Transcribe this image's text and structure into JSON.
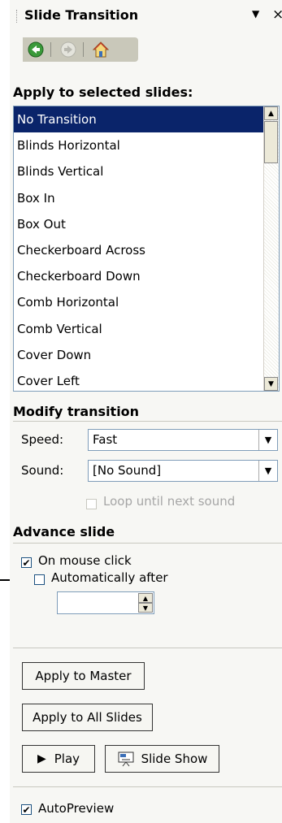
{
  "panel": {
    "title": "Slide Transition",
    "menu_glyph": "▼",
    "close_glyph": "×"
  },
  "nav": {
    "back_icon": "back-arrow-icon",
    "forward_icon": "forward-arrow-icon",
    "home_icon": "home-icon"
  },
  "apply_section": {
    "heading": "Apply to selected slides:",
    "items": [
      "No Transition",
      "Blinds Horizontal",
      "Blinds Vertical",
      "Box In",
      "Box Out",
      "Checkerboard Across",
      "Checkerboard Down",
      "Comb Horizontal",
      "Comb Vertical",
      "Cover Down",
      "Cover Left"
    ],
    "selected_index": 0
  },
  "modify": {
    "heading": "Modify transition",
    "speed_label": "Speed:",
    "speed_value": "Fast",
    "sound_label": "Sound:",
    "sound_value": "[No Sound]",
    "loop_label": "Loop until next sound",
    "loop_checked": false
  },
  "advance": {
    "heading": "Advance slide",
    "mouse_click_label": "On mouse click",
    "mouse_click_checked": true,
    "auto_label": "Automatically after",
    "auto_checked": false,
    "auto_value": ""
  },
  "buttons": {
    "apply_master": "Apply to Master",
    "apply_all": "Apply to All Slides",
    "play": "Play",
    "slide_show": "Slide Show"
  },
  "autopreview": {
    "label": "AutoPreview",
    "checked": true
  },
  "colors": {
    "selection": "#0a246a",
    "panel_bg": "#f7f7f4",
    "nav_bar": "#c9c8ba"
  }
}
